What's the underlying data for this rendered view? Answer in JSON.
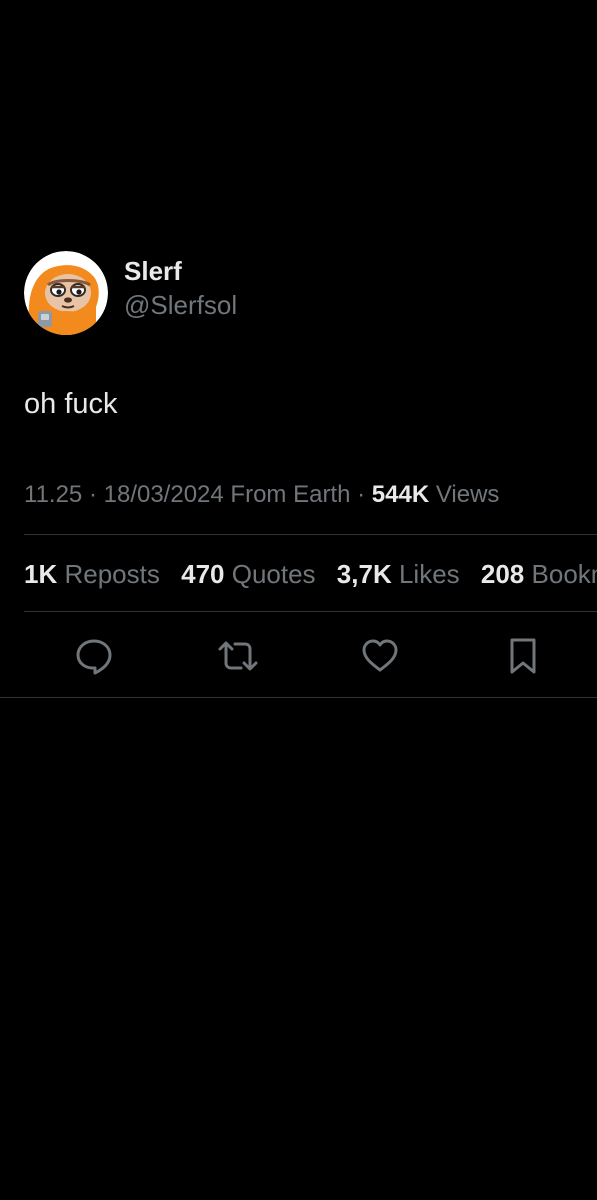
{
  "author": {
    "display_name": "Slerf",
    "handle": "@Slerfsol",
    "avatar_icon": "sloth-avatar"
  },
  "tweet": {
    "text": "oh fuck"
  },
  "meta": {
    "time": "11.25",
    "separator_1": "·",
    "date": "18/03/2024",
    "source": "From Earth",
    "separator_2": "·",
    "views_count": "544K",
    "views_label": "Views"
  },
  "stats": {
    "reposts_count": "1K",
    "reposts_label": "Reposts",
    "quotes_count": "470",
    "quotes_label": "Quotes",
    "likes_count": "3,7K",
    "likes_label": "Likes",
    "bookmarks_count": "208",
    "bookmarks_label": "Bookmarks"
  },
  "actions": {
    "reply_icon": "reply-icon",
    "repost_icon": "repost-icon",
    "like_icon": "heart-icon",
    "bookmark_icon": "bookmark-icon"
  },
  "colors": {
    "background": "#000000",
    "primary_text": "#e7e9ea",
    "secondary_text": "#71767b",
    "divider": "#2f3336",
    "avatar_orange": "#f28a1d"
  }
}
